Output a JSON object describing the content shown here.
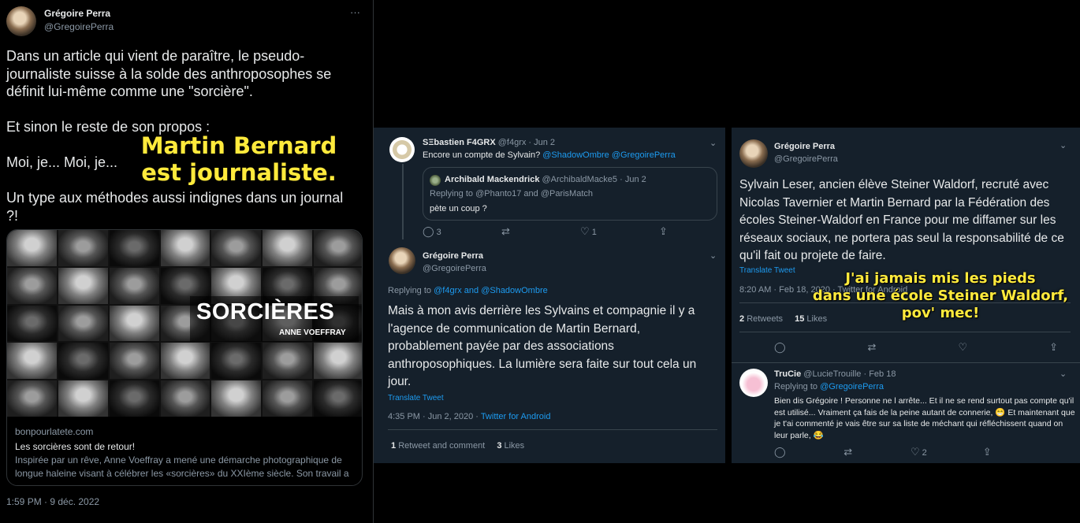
{
  "left_tweet": {
    "author_name": "Grégoire Perra",
    "author_handle": "@GregoirePerra",
    "more": "···",
    "text": "Dans un article qui vient de paraître, le pseudo-journaliste suisse à la solde des anthroposophes se définit lui-même comme une \"sorcière\".\n\nEt sinon le reste de son propos :\n\nMoi, je... Moi, je...\n\nUn type aux méthodes aussi indignes dans un journal ?!",
    "overlay_line1": "Martin Bernard",
    "overlay_line2": "est journaliste.",
    "card": {
      "image_title": "SORCIÈRES",
      "image_subtitle": "ANNE VOEFFRAY",
      "domain": "bonpourlatete.com",
      "title": "Les sorcières sont de retour!",
      "description": "Inspirée par un rêve, Anne Voeffray a mené une démarche photographique de longue haleine visant à célébrer les «sorcières» du XXIème siècle. Son travail a …"
    },
    "timestamp": "1:59 PM · 9 déc. 2022"
  },
  "middle": {
    "tweet1": {
      "name": "SΞbastien F4GRX",
      "handle": "@f4grx",
      "date": "· Jun 2",
      "text_prefix": "Encore un compte de Sylvain?",
      "mention1": "@ShadowOmbre",
      "mention2": "@GregoirePerra",
      "quote": {
        "name": "Archibald Mackendrick",
        "handle": "@ArchibaldMacke5",
        "date": "· Jun 2",
        "replying": "Replying to @Phanto17 and @ParisMatch",
        "text": "pète un coup ?"
      },
      "actions": {
        "reply": "3",
        "retweet": "",
        "like": "1"
      }
    },
    "tweet2": {
      "name": "Grégoire Perra",
      "handle": "@GregoirePerra",
      "replying_prefix": "Replying to",
      "replying_handles": "@f4grx and @ShadowOmbre",
      "text": "Mais à mon avis derrière les Sylvains et compagnie il y a l'agence de communication de Martin Bernard, probablement payée par des associations anthroposophiques. La lumière sera faite sur tout cela un jour.",
      "translate": "Translate Tweet",
      "time": "4:35 PM · Jun 2, 2020 ·",
      "source": "Twitter for Android",
      "stats": [
        {
          "count": "1",
          "label": "Retweet and comment"
        },
        {
          "count": "3",
          "label": "Likes"
        }
      ]
    }
  },
  "right": {
    "tweet1": {
      "name": "Grégoire Perra",
      "handle": "@GregoirePerra",
      "text": "Sylvain Leser, ancien élève Steiner Waldorf,  recruté avec Nicolas Tavernier et Martin Bernard par la Fédération des écoles Steiner-Waldorf en France pour me diffamer sur les réseaux sociaux,  ne portera pas seul la responsabilité de ce qu'il fait ou projete de faire.",
      "translate": "Translate Tweet",
      "time": "8:20 AM · Feb 18, 2020 · Twitter for Android",
      "stats": [
        {
          "count": "2",
          "label": "Retweets"
        },
        {
          "count": "15",
          "label": "Likes"
        }
      ],
      "overlay": "J'ai jamais mis les pieds\ndans une école Steiner Waldorf,\npov' mec!"
    },
    "reply": {
      "name": "TruCie",
      "handle": "@LucieTrouille",
      "date": "· Feb 18",
      "replying_prefix": "Replying to",
      "replying_handle": "@GregoirePerra",
      "text": "Bien dis Grégoire ! Personne ne l arrête... Et il ne se rend surtout pas compte qu'il est utilisé... Vraiment ça fais de la peine autant de connerie, 😁 Et maintenant que je t'ai commenté je vais être sur sa liste de méchant qui réfléchissent quand on leur parle, 😂",
      "actions": {
        "like": "2"
      }
    }
  },
  "colors": {
    "link": "#1d9bf0",
    "panel": "#15202b",
    "overlay": "#ffea3c"
  },
  "icons": [
    "reply-icon",
    "retweet-icon",
    "like-icon",
    "share-icon",
    "chevron-down-icon",
    "more-icon"
  ]
}
